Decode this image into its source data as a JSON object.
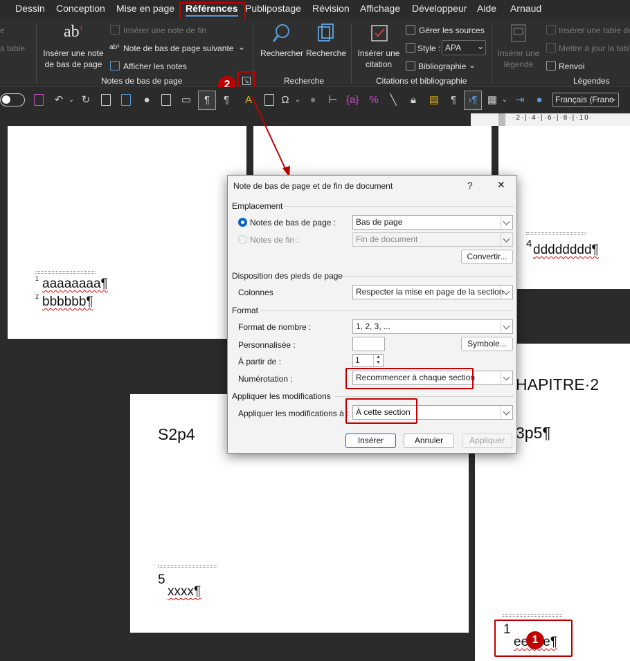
{
  "menu": {
    "items": [
      "Dessin",
      "Conception",
      "Mise en page",
      "Références",
      "Publipostage",
      "Révision",
      "Affichage",
      "Développeur",
      "Aide",
      "Arnaud"
    ]
  },
  "ribbon": {
    "left_fragments": [
      "e",
      "a table"
    ],
    "footnotes": {
      "insert_footnote": "Insérer une note de bas de page",
      "insert_endnote": "Insérer une note de fin",
      "next_footnote": "Note de bas de page suivante",
      "show_notes": "Afficher les notes",
      "group_label": "Notes de bas de page"
    },
    "research": {
      "search1": "Rechercher",
      "search2": "Recherche",
      "group_label": "Recherche"
    },
    "citations": {
      "insert_citation": "Insérer une citation",
      "manage_sources": "Gérer les sources",
      "style_label": "Style :",
      "style_value": "APA",
      "bibliography": "Bibliographie",
      "group_label": "Citations et bibliographie"
    },
    "captions": {
      "insert_caption": "Insérer une légende",
      "insert_table": "Insérer une table de",
      "update_table": "Mettre à jour la table",
      "cross_ref": "Renvoi",
      "group_label": "Légendes"
    }
  },
  "qat": {
    "language": "Français (Franc"
  },
  "ruler": {
    "marks": "·2·|·4·|·6·|·8·|·10·"
  },
  "document": {
    "page1": {
      "fn1": "aaaaaaaa¶",
      "fn2": "bbbbbb¶",
      "num1": "1",
      "num2": "2"
    },
    "page2": {
      "fn": "dddddddd¶",
      "num": "4"
    },
    "page3": {
      "heading": "S2p4",
      "fn": "xxxx¶",
      "num": "5"
    },
    "page4": {
      "heading": "HAPITRE·2",
      "subheading": "3p5¶",
      "fn": "eeeee¶",
      "num": "1"
    }
  },
  "annotations": {
    "badge1": "1",
    "badge2": "2"
  },
  "dialog": {
    "title": "Note de bas de page et de fin de document",
    "help": "?",
    "close": "✕",
    "emplacement": "Emplacement",
    "footnotes_label": "Notes de bas de page :",
    "footnotes_value": "Bas de page",
    "endnotes_label": "Notes de fin :",
    "endnotes_value": "Fin de document",
    "convert": "Convertir...",
    "layout_section": "Disposition des pieds de page",
    "columns_label": "Colonnes",
    "columns_value": "Respecter la mise en page de la section",
    "format_section": "Format",
    "number_format_label": "Format de nombre :",
    "number_format_value": "1, 2, 3, ...",
    "custom_label": "Personnalisée :",
    "custom_value": "",
    "symbol": "Symbole...",
    "start_at_label": "À partir de :",
    "start_at_value": "1",
    "numbering_label": "Numérotation :",
    "numbering_value": "Recommencer à chaque section",
    "apply_section": "Appliquer les modifications",
    "apply_label": "Appliquer les modifications à :",
    "apply_value": "À cette section",
    "insert": "Insérer",
    "cancel": "Annuler",
    "apply": "Appliquer"
  },
  "colors": {
    "accent": "#0a64c8",
    "highlight": "#c00000",
    "dark_bg": "#2b2b2b"
  }
}
